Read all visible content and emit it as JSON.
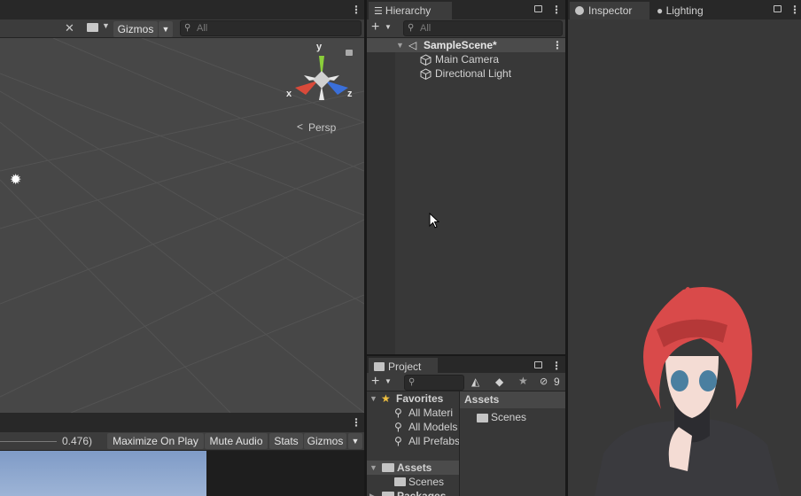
{
  "scene": {
    "gizmos_label": "Gizmos",
    "search_placeholder": "All",
    "axis_y": "y",
    "axis_x": "x",
    "axis_z": "z",
    "persp_label": "Persp"
  },
  "game": {
    "scale_value": "0.476)",
    "buttons": [
      "Maximize On Play",
      "Mute Audio",
      "Stats",
      "Gizmos"
    ]
  },
  "hierarchy": {
    "tab": "Hierarchy",
    "search_placeholder": "All",
    "scene_name": "SampleScene*",
    "items": [
      "Main Camera",
      "Directional Light"
    ]
  },
  "inspector": {
    "tab": "Inspector",
    "lighting_tab": "Lighting"
  },
  "project": {
    "tab": "Project",
    "hidden_count": "9",
    "favorites": {
      "label": "Favorites",
      "items": [
        "All Materi",
        "All Models",
        "All Prefabs"
      ]
    },
    "assets_label": "Assets",
    "assets_children": [
      "Scenes"
    ],
    "packages_label": "Packages",
    "breadcrumb": "Assets",
    "grid_items": [
      "Scenes"
    ]
  },
  "colors": {
    "accent_x": "#d94a3a",
    "accent_y": "#8bcf3a",
    "accent_z": "#3a6fd9",
    "panel": "#383838",
    "tabbar": "#282828"
  }
}
